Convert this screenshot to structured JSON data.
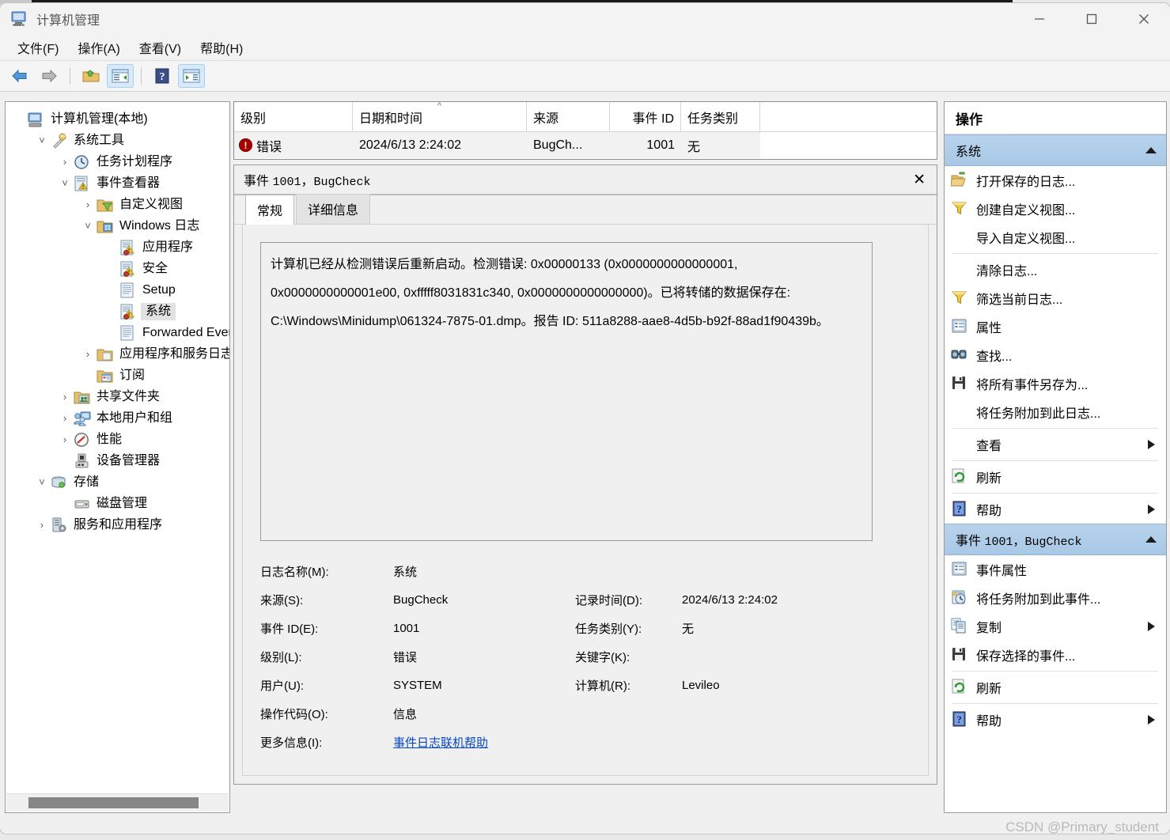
{
  "window": {
    "title": "计算机管理",
    "icon": "computer-management-icon",
    "controls": {
      "minimize": "—",
      "maximize": "□",
      "close": "✕"
    }
  },
  "menubar": [
    {
      "label": "文件(F)",
      "name": "menu-file"
    },
    {
      "label": "操作(A)",
      "name": "menu-action"
    },
    {
      "label": "查看(V)",
      "name": "menu-view"
    },
    {
      "label": "帮助(H)",
      "name": "menu-help"
    }
  ],
  "toolbar": [
    {
      "name": "back-icon",
      "label": "后退"
    },
    {
      "name": "forward-icon",
      "label": "前进"
    },
    {
      "name": "up-folder-icon",
      "label": "上移一级"
    },
    {
      "name": "show-hide-tree-icon",
      "label": "显示/隐藏控制台树"
    },
    {
      "name": "help-icon",
      "label": "帮助"
    },
    {
      "name": "show-hide-actions-icon",
      "label": "显示/隐藏操作窗格"
    }
  ],
  "tree": [
    {
      "label": "计算机管理(本地)",
      "indent": 0,
      "twisty": "",
      "icon": "computer-icon",
      "selected": false
    },
    {
      "label": "系统工具",
      "indent": 1,
      "twisty": "˅",
      "icon": "tools-icon",
      "selected": false
    },
    {
      "label": "任务计划程序",
      "indent": 2,
      "twisty": "›",
      "icon": "clock-icon",
      "selected": false
    },
    {
      "label": "事件查看器",
      "indent": 2,
      "twisty": "˅",
      "icon": "event-viewer-icon",
      "selected": false
    },
    {
      "label": "自定义视图",
      "indent": 3,
      "twisty": "›",
      "icon": "custom-view-icon",
      "selected": false
    },
    {
      "label": "Windows 日志",
      "indent": 3,
      "twisty": "˅",
      "icon": "windows-logs-icon",
      "selected": false
    },
    {
      "label": "应用程序",
      "indent": 4,
      "twisty": "",
      "icon": "log-warning-icon",
      "selected": false
    },
    {
      "label": "安全",
      "indent": 4,
      "twisty": "",
      "icon": "log-warning-icon",
      "selected": false
    },
    {
      "label": "Setup",
      "indent": 4,
      "twisty": "",
      "icon": "log-plain-icon",
      "selected": false
    },
    {
      "label": "系统",
      "indent": 4,
      "twisty": "",
      "icon": "log-warning-icon",
      "selected": true
    },
    {
      "label": "Forwarded Even",
      "indent": 4,
      "twisty": "",
      "icon": "log-plain-icon",
      "selected": false
    },
    {
      "label": "应用程序和服务日志",
      "indent": 3,
      "twisty": "›",
      "icon": "folder-icon",
      "selected": false
    },
    {
      "label": "订阅",
      "indent": 3,
      "twisty": "",
      "icon": "subscription-icon",
      "selected": false
    },
    {
      "label": "共享文件夹",
      "indent": 2,
      "twisty": "›",
      "icon": "shared-folders-icon",
      "selected": false
    },
    {
      "label": "本地用户和组",
      "indent": 2,
      "twisty": "›",
      "icon": "users-groups-icon",
      "selected": false
    },
    {
      "label": "性能",
      "indent": 2,
      "twisty": "›",
      "icon": "performance-icon",
      "selected": false
    },
    {
      "label": "设备管理器",
      "indent": 2,
      "twisty": "",
      "icon": "device-manager-icon",
      "selected": false
    },
    {
      "label": "存储",
      "indent": 1,
      "twisty": "˅",
      "icon": "storage-icon",
      "selected": false
    },
    {
      "label": "磁盘管理",
      "indent": 2,
      "twisty": "",
      "icon": "disk-management-icon",
      "selected": false
    },
    {
      "label": "服务和应用程序",
      "indent": 1,
      "twisty": "›",
      "icon": "services-icon",
      "selected": false
    }
  ],
  "event_list": {
    "columns": [
      "级别",
      "日期和时间",
      "来源",
      "事件 ID",
      "任务类别",
      ""
    ],
    "sort_indicator": "^",
    "rows": [
      {
        "level": "错误",
        "level_icon": "error-icon",
        "datetime": "2024/6/13 2:24:02",
        "source": "BugCh...",
        "event_id": "1001",
        "task_category": "无"
      }
    ]
  },
  "details": {
    "header_prefix": "事件 ",
    "header_id": "1001",
    "header_sep": "，",
    "header_source": "BugCheck",
    "close_label": "✕",
    "tabs": [
      {
        "label": "常规",
        "active": true
      },
      {
        "label": "详细信息",
        "active": false
      }
    ],
    "description": "计算机已经从检测错误后重新启动。检测错误: 0x00000133 (0x0000000000000001, 0x0000000000001e00, 0xfffff8031831c340, 0x0000000000000000)。已将转储的数据保存在: C:\\Windows\\Minidump\\061324-7875-01.dmp。报告 ID: 511a8288-aae8-4d5b-b92f-88ad1f90439b。",
    "fields": [
      {
        "label": "日志名称(M):",
        "value": "系统",
        "label2": "",
        "value2": ""
      },
      {
        "label": "来源(S):",
        "value": "BugCheck",
        "label2": "记录时间(D):",
        "value2": "2024/6/13 2:24:02"
      },
      {
        "label": "事件 ID(E):",
        "value": "1001",
        "label2": "任务类别(Y):",
        "value2": "无"
      },
      {
        "label": "级别(L):",
        "value": "错误",
        "label2": "关键字(K):",
        "value2": ""
      },
      {
        "label": "用户(U):",
        "value": "SYSTEM",
        "label2": "计算机(R):",
        "value2": "Levileo"
      },
      {
        "label": "操作代码(O):",
        "value": "信息",
        "label2": "",
        "value2": ""
      },
      {
        "label": "更多信息(I):",
        "value": "事件日志联机帮助",
        "label2": "",
        "value2": "",
        "is_link": true
      }
    ]
  },
  "actions": {
    "title": "操作",
    "groups": [
      {
        "name": "system",
        "header": "系统",
        "header_mono": "",
        "items": [
          {
            "label": "打开保存的日志...",
            "icon": "open-folder-icon",
            "submenu": false,
            "sep_after": false
          },
          {
            "label": "创建自定义视图...",
            "icon": "filter-icon",
            "submenu": false,
            "sep_after": false
          },
          {
            "label": "导入自定义视图...",
            "icon": "",
            "submenu": false,
            "sep_after": true
          },
          {
            "label": "清除日志...",
            "icon": "",
            "submenu": false,
            "sep_after": false
          },
          {
            "label": "筛选当前日志...",
            "icon": "filter-icon",
            "submenu": false,
            "sep_after": false
          },
          {
            "label": "属性",
            "icon": "properties-icon",
            "submenu": false,
            "sep_after": false
          },
          {
            "label": "查找...",
            "icon": "find-icon",
            "submenu": false,
            "sep_after": false
          },
          {
            "label": "将所有事件另存为...",
            "icon": "save-icon",
            "submenu": false,
            "sep_after": false
          },
          {
            "label": "将任务附加到此日志...",
            "icon": "",
            "submenu": false,
            "sep_after": true
          },
          {
            "label": "查看",
            "icon": "",
            "submenu": true,
            "sep_after": true
          },
          {
            "label": "刷新",
            "icon": "refresh-icon",
            "submenu": false,
            "sep_after": true
          },
          {
            "label": "帮助",
            "icon": "help-icon",
            "submenu": true,
            "sep_after": false
          }
        ]
      },
      {
        "name": "event-1001-bugcheck",
        "header": "事件 ",
        "header_mono": "1001，BugCheck",
        "items": [
          {
            "label": "事件属性",
            "icon": "properties-icon",
            "submenu": false,
            "sep_after": false
          },
          {
            "label": "将任务附加到此事件...",
            "icon": "attach-task-icon",
            "submenu": false,
            "sep_after": false
          },
          {
            "label": "复制",
            "icon": "copy-icon",
            "submenu": true,
            "sep_after": false
          },
          {
            "label": "保存选择的事件...",
            "icon": "save-icon",
            "submenu": false,
            "sep_after": true
          },
          {
            "label": "刷新",
            "icon": "refresh-icon",
            "submenu": false,
            "sep_after": true
          },
          {
            "label": "帮助",
            "icon": "help-icon",
            "submenu": true,
            "sep_after": false
          }
        ]
      }
    ]
  },
  "watermark": "CSDN @Primary_student",
  "colors": {
    "accent": "#a8c8e6",
    "error": "#a80000",
    "link": "#0645c0",
    "selection": "#e2e2e2"
  }
}
